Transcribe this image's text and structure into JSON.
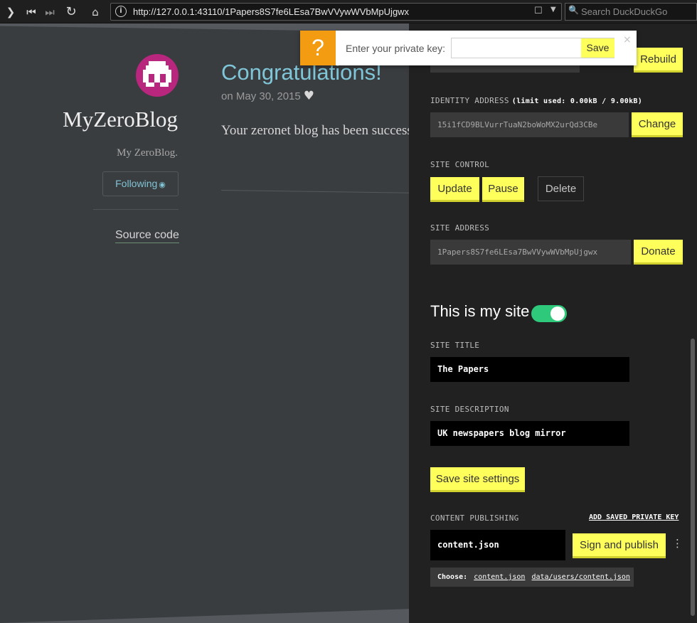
{
  "browser": {
    "url": "http://127.0.0.1:43110/1Papers8S7fe6LEsa7BwVVywWVbMpUjgwx",
    "search_placeholder": "Search DuckDuckGo",
    "icons": [
      "forward-icon",
      "first-page-icon",
      "last-page-icon",
      "reload-icon",
      "home-icon",
      "info-icon",
      "bookmark-icon",
      "dropdown-icon",
      "search-icon"
    ]
  },
  "notification": {
    "icon": "?",
    "message": "Enter your private key:",
    "input_value": "",
    "save_label": "Save",
    "close_label": "×"
  },
  "blog": {
    "title": "MyZeroBlog",
    "description": "My ZeroBlog.",
    "follow_label": "Following",
    "source_link": "Source code",
    "post_title": "Congratulations!",
    "post_date": "on May 30, 2015",
    "post_body": "Your zeronet blog has been successfully deployed!"
  },
  "sidebar": {
    "rebuild_label": "Rebuild",
    "identity": {
      "label": "IDENTITY ADDRESS",
      "limit": "(limit used: 0.00kB / 9.00kB)",
      "value": "15i1fCD9BLVurrTuaN2boWoMX2urQd3CBe",
      "change_label": "Change"
    },
    "site_control": {
      "label": "SITE CONTROL",
      "update_label": "Update",
      "pause_label": "Pause",
      "delete_label": "Delete"
    },
    "site_address": {
      "label": "SITE ADDRESS",
      "value": "1Papers8S7fe6LEsa7BwVVywWVbMpUjgwx",
      "donate_label": "Donate"
    },
    "my_site": {
      "label": "This is my site",
      "toggle_on": true
    },
    "site_title": {
      "label": "SITE TITLE",
      "value": "The Papers"
    },
    "site_description": {
      "label": "SITE DESCRIPTION",
      "value": "UK newspapers blog mirror"
    },
    "save_settings_label": "Save site settings",
    "publishing": {
      "label": "CONTENT PUBLISHING",
      "add_key_label": "ADD SAVED PRIVATE KEY",
      "file_value": "content.json",
      "sign_label": "Sign and publish",
      "menu_label": "⋮",
      "choose_label": "Choose:",
      "choose_options": [
        "content.json",
        "data/users/content.json"
      ]
    }
  },
  "colors": {
    "accent_yellow": "#ffff5c",
    "toggle_green": "#2ec97a",
    "notification_orange": "#f39c12",
    "blog_title_blue": "#7fc6d9",
    "avatar_magenta": "#b8267e"
  }
}
